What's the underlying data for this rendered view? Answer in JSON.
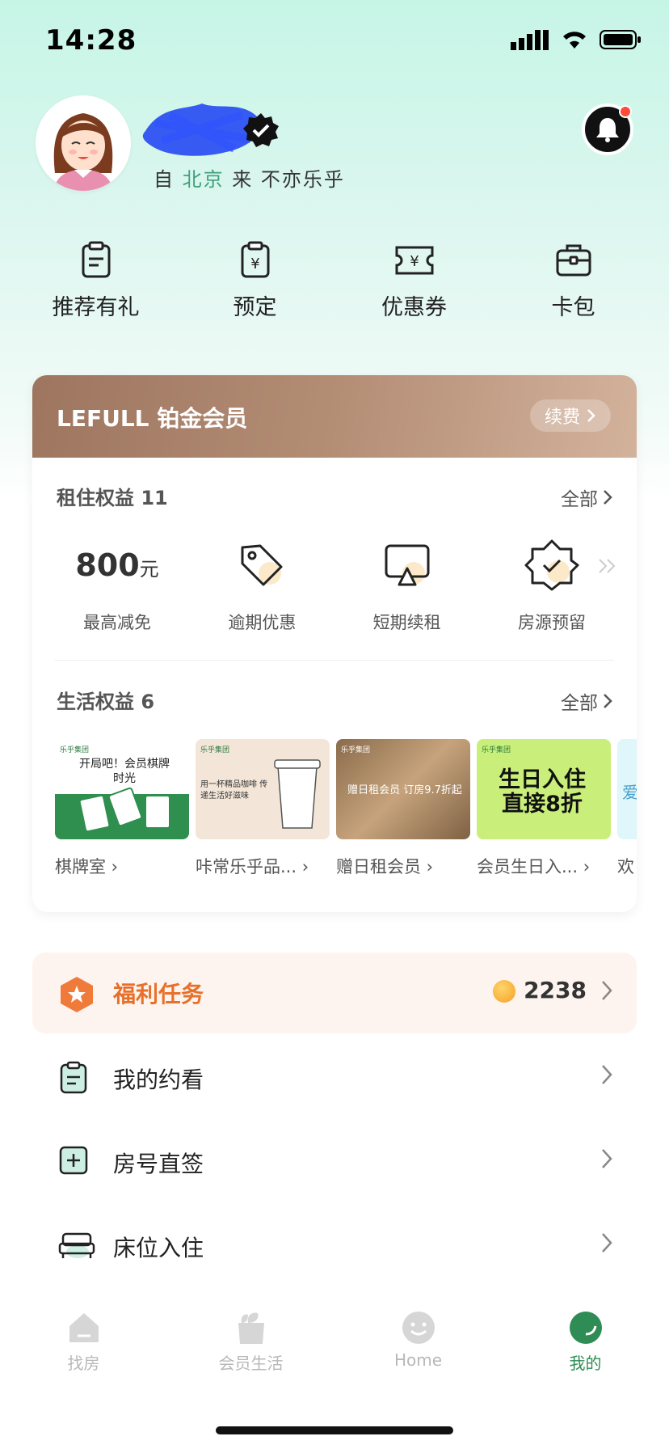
{
  "status_bar": {
    "time": "14:28"
  },
  "profile": {
    "prefix": "自",
    "city": "北京",
    "middle": "来",
    "slogan": "不亦乐乎"
  },
  "quick_actions": [
    {
      "label": "推荐有礼",
      "icon": "clipboard-icon"
    },
    {
      "label": "预定",
      "icon": "yuan-clipboard-icon"
    },
    {
      "label": "优惠券",
      "icon": "coupon-icon"
    },
    {
      "label": "卡包",
      "icon": "wallet-icon"
    }
  ],
  "membership": {
    "title": "LEFULL 铂金会员",
    "renew_label": "续费",
    "colors": {
      "header_start": "#9e7660",
      "header_end": "#d3b29c"
    }
  },
  "rental_rights": {
    "title": "租住权益 11",
    "more": "全部",
    "items": [
      {
        "value": "800",
        "unit": "元",
        "label": "最高减免"
      },
      {
        "label": "逾期优惠",
        "icon": "tag-icon"
      },
      {
        "label": "短期续租",
        "icon": "screen-icon"
      },
      {
        "label": "房源预留",
        "icon": "badge-check-icon"
      }
    ]
  },
  "life_rights": {
    "title": "生活权益 6",
    "more": "全部",
    "items": [
      {
        "label": "棋牌室",
        "image_text": "开局吧！会员棋牌时光",
        "brand": "乐乎集团"
      },
      {
        "label": "咔常乐乎品...",
        "image_text": "用一杯精品咖啡 传递生活好滋味",
        "brand": "乐乎集团"
      },
      {
        "label": "赠日租会员",
        "image_text": "赠日租会员 订房9.7折起",
        "brand": "乐乎集团"
      },
      {
        "label": "会员生日入...",
        "image_text": "生日入住 直接8折",
        "brand": "乐乎集团"
      },
      {
        "label": "欢",
        "image_text": "爱"
      }
    ]
  },
  "welfare": {
    "label": "福利任务",
    "points": "2238",
    "accent": "#e7702b"
  },
  "menu": [
    {
      "label": "我的约看",
      "icon": "clipboard-icon"
    },
    {
      "label": "房号直签",
      "icon": "plus-box-icon"
    },
    {
      "label": "床位入住",
      "icon": "bed-icon"
    }
  ],
  "tabbar": [
    {
      "label": "找房",
      "active": false
    },
    {
      "label": "会员生活",
      "active": false
    },
    {
      "label": "Home",
      "active": false
    },
    {
      "label": "我的",
      "active": true
    }
  ]
}
